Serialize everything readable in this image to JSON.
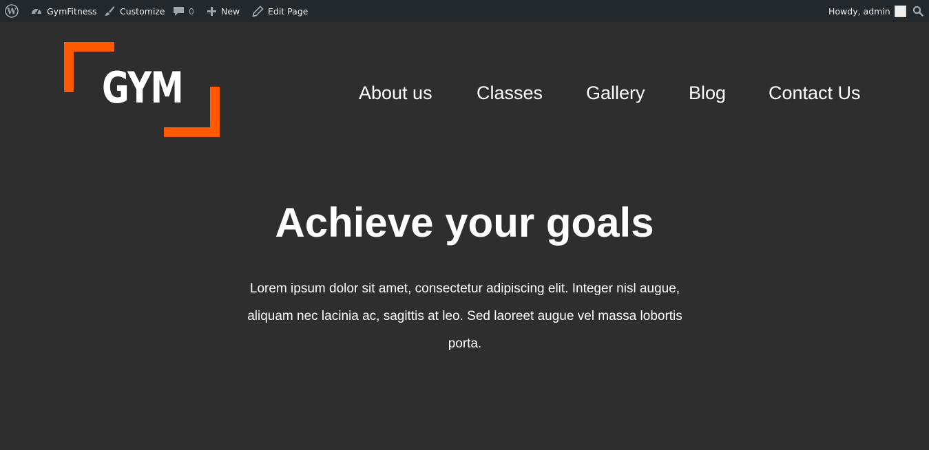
{
  "admin_bar": {
    "wp_logo_icon": "wordpress-icon",
    "site_name": "GymFitness",
    "customize": "Customize",
    "comments_count": "0",
    "new": "New",
    "edit_page": "Edit Page",
    "howdy": "Howdy, admin"
  },
  "header": {
    "logo_text": "GYM",
    "logo_color": "#ff5a00",
    "nav": [
      "About us",
      "Classes",
      "Gallery",
      "Blog",
      "Contact Us"
    ]
  },
  "hero": {
    "title": "Achieve your goals",
    "text": "Lorem ipsum dolor sit amet, consectetur adipiscing elit. Integer nisl augue, aliquam nec lacinia ac, sagittis at leo. Sed laoreet augue vel massa lobortis porta."
  },
  "colors": {
    "admin_bar_bg": "#23282d",
    "page_bg": "#2e2e2e",
    "accent": "#ff5a00"
  }
}
